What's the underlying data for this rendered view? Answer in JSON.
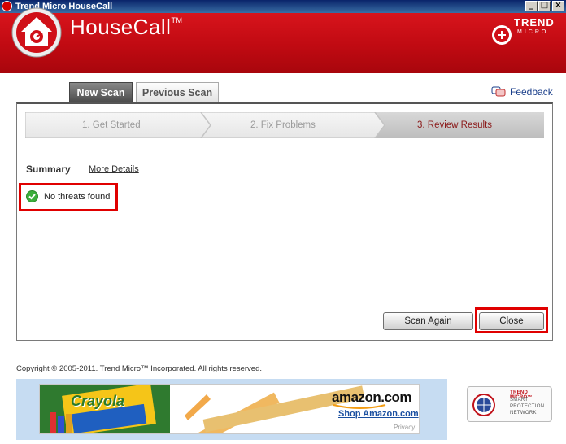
{
  "window": {
    "title": "Trend Micro HouseCall",
    "minimize": "_",
    "maximize": "□",
    "close": "×"
  },
  "header": {
    "brand": "HouseCall",
    "brand_tm": "TM",
    "vendor_line1": "TREND",
    "vendor_line2": "MICRO"
  },
  "tabs": [
    {
      "label": "New Scan",
      "active": true
    },
    {
      "label": "Previous Scan",
      "active": false
    }
  ],
  "feedback": {
    "label": "Feedback"
  },
  "steps": [
    {
      "label": "1. Get Started",
      "active": false
    },
    {
      "label": "2. Fix Problems",
      "active": false
    },
    {
      "label": "3. Review Results",
      "active": true
    }
  ],
  "summary": {
    "heading": "Summary",
    "more_details": "More Details",
    "result": "No threats found"
  },
  "buttons": {
    "scan_again": "Scan Again",
    "close": "Close"
  },
  "footer": {
    "copyright": "Copyright © 2005-2011. Trend Micro™ Incorporated. All rights reserved."
  },
  "ad": {
    "brand_text": "Crayola",
    "amazon": "amazon.com",
    "shop": "Shop Amazon.com",
    "privacy": "Privacy"
  },
  "spn_badge": {
    "line1": "TREND MICRO™",
    "line2": "SMART",
    "line3": "PROTECTION",
    "line4": "NETWORK"
  },
  "colors": {
    "header_red": "#c00a12",
    "highlight_red": "#e00000",
    "ok_green": "#3cae3c",
    "active_step": "#8b1a1a"
  }
}
